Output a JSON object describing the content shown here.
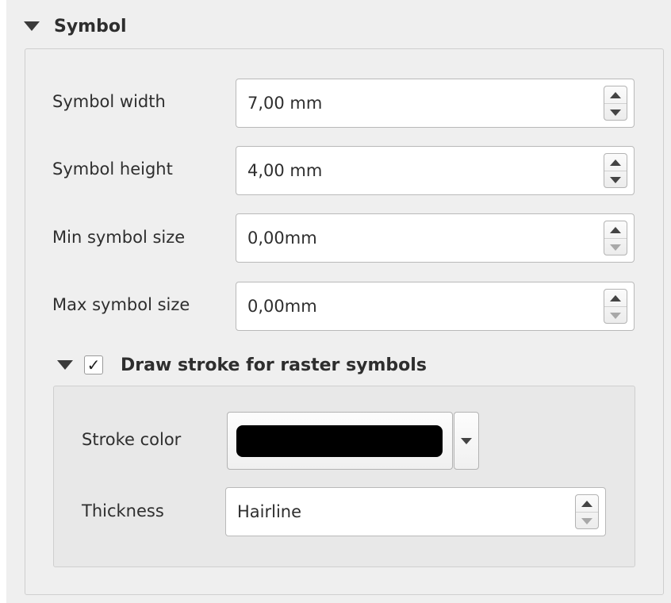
{
  "section": {
    "title": "Symbol",
    "expanded": true
  },
  "fields": [
    {
      "label": "Symbol width",
      "value": "7,00 mm"
    },
    {
      "label": "Symbol height",
      "value": "4,00 mm"
    },
    {
      "label": "Min symbol size",
      "value": "0,00mm"
    },
    {
      "label": "Max symbol size",
      "value": "0,00mm"
    }
  ],
  "stroke_group": {
    "title": "Draw stroke for raster symbols",
    "checked": true,
    "check_glyph": "✓",
    "expanded": true,
    "color_label": "Stroke color",
    "color_value": "#000000",
    "thickness_label": "Thickness",
    "thickness_value": "Hairline"
  },
  "icons": {
    "collapse": "triangle-down-icon",
    "spin_up": "arrow-up-icon",
    "spin_down": "arrow-down-icon",
    "dropdown": "chevron-down-icon"
  }
}
